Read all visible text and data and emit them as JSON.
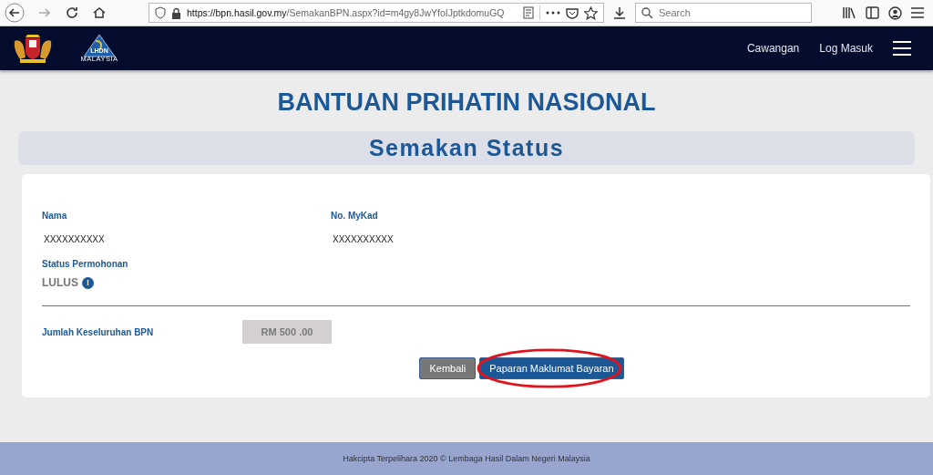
{
  "browser": {
    "url_prefix": "https://bpn.",
    "url_domain": "hasil.gov.my",
    "url_rest": "/SemakanBPN.aspx?id=m4gy8JwYfoIJptkdomuGQ",
    "search_placeholder": "Search"
  },
  "nav": {
    "logo_text": "LHDN",
    "logo_subtext": "MALAYSIA",
    "links": [
      "Cawangan",
      "Log Masuk"
    ]
  },
  "page_title": "BANTUAN PRIHATIN NASIONAL",
  "section_title": "Semakan Status",
  "fields": [
    {
      "label": "Nama",
      "value": "XXXXXXXXXX"
    },
    {
      "label": "No. MyKad",
      "value": "XXXXXXXXXX"
    }
  ],
  "status": {
    "label": "Status Permohonan",
    "value": "LULUS",
    "info": "!"
  },
  "total": {
    "label": "Jumlah Keseluruhan BPN",
    "value": "RM 500 .00"
  },
  "buttons": [
    {
      "label": "Kembali",
      "kind": "secondary",
      "highlighted": false
    },
    {
      "label": "Paparan Maklumat Bayaran",
      "kind": "primary",
      "highlighted": true
    }
  ],
  "footer": "Hakcipta Terpelihara 2020 © Lembaga Hasil Dalam Negeri Malaysia"
}
